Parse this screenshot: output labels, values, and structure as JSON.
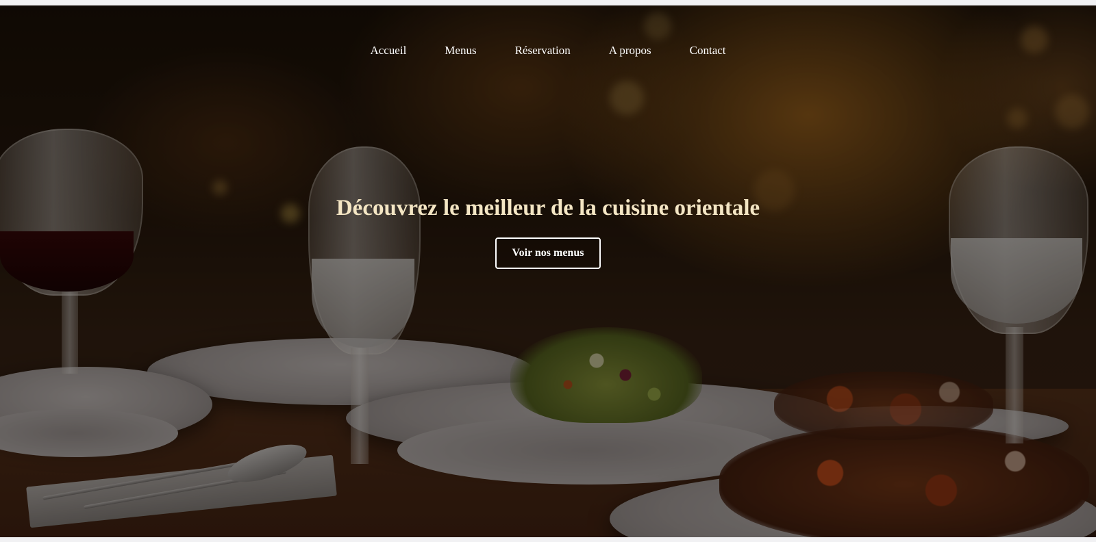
{
  "nav": {
    "items": [
      {
        "label": "Accueil"
      },
      {
        "label": "Menus"
      },
      {
        "label": "Réservation"
      },
      {
        "label": "A propos"
      },
      {
        "label": "Contact"
      }
    ]
  },
  "hero": {
    "title": "Découvrez le meilleur de la cuisine orientale",
    "cta_label": "Voir nos menus",
    "background_image": "restaurant table with plates, salad and wine glasses"
  },
  "colors": {
    "title": "#f4e6c4",
    "nav_text": "#ffffff",
    "button_border": "#ffffff",
    "overlay": "rgba(0,0,0,0.45)"
  }
}
